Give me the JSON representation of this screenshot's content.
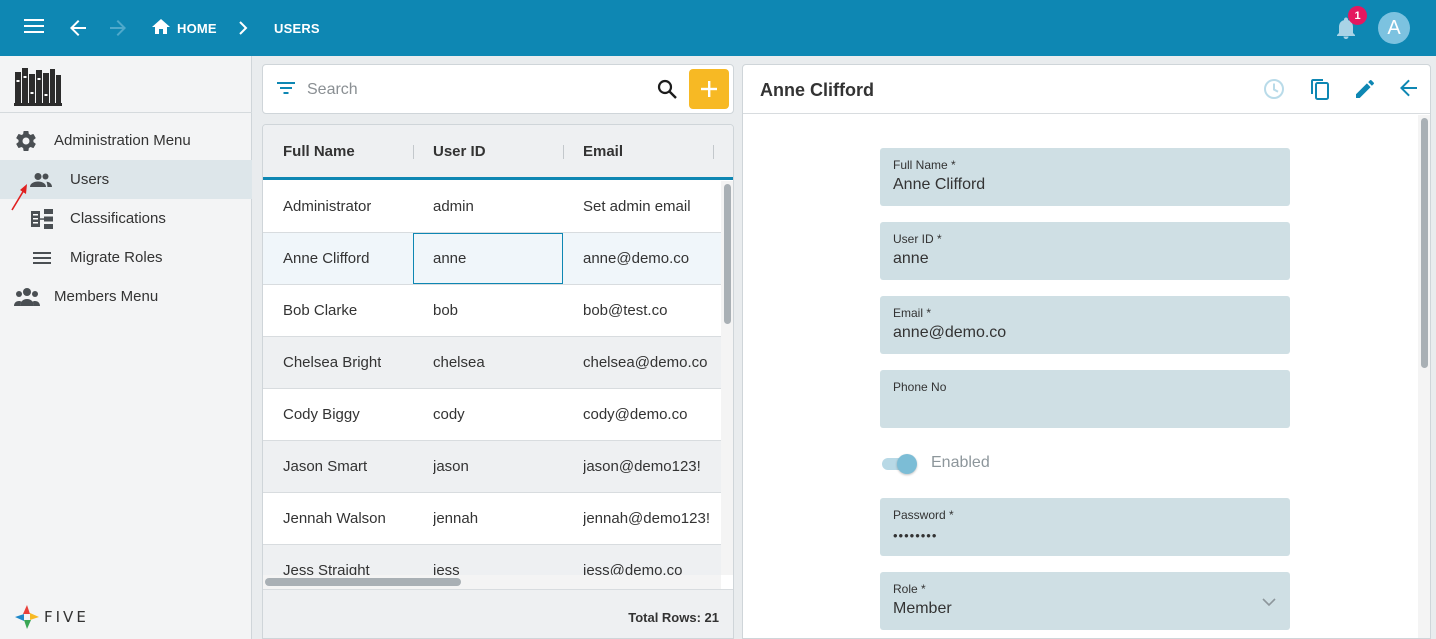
{
  "topbar": {
    "breadcrumbs": [
      "HOME",
      "USERS"
    ],
    "notification_count": "1",
    "avatar_initial": "A"
  },
  "sidebar": {
    "items": [
      {
        "label": "Administration Menu",
        "icon": "gear-icon"
      },
      {
        "label": "Users",
        "icon": "people-icon",
        "active": true
      },
      {
        "label": "Classifications",
        "icon": "tree-icon"
      },
      {
        "label": "Migrate Roles",
        "icon": "lines-icon"
      },
      {
        "label": "Members Menu",
        "icon": "group-icon"
      }
    ],
    "brand": "FIVE"
  },
  "search": {
    "placeholder": "Search"
  },
  "grid": {
    "columns": [
      "Full Name",
      "User ID",
      "Email"
    ],
    "rows": [
      [
        "Administrator",
        "admin",
        "Set admin email"
      ],
      [
        "Anne Clifford",
        "anne",
        "anne@demo.co"
      ],
      [
        "Bob Clarke",
        "bob",
        "bob@test.co"
      ],
      [
        "Chelsea Bright",
        "chelsea",
        "chelsea@demo.co"
      ],
      [
        "Cody Biggy",
        "cody",
        "cody@demo.co"
      ],
      [
        "Jason Smart",
        "jason",
        "jason@demo123!"
      ],
      [
        "Jennah Walson",
        "jennah",
        "jennah@demo123!"
      ],
      [
        "Jess Straight",
        "jess",
        "jess@demo.co"
      ]
    ],
    "selected_row": 1,
    "total_label": "Total Rows: 21"
  },
  "detail": {
    "title": "Anne Clifford",
    "fields": [
      {
        "label": "Full Name *",
        "value": "Anne Clifford"
      },
      {
        "label": "User ID *",
        "value": "anne"
      },
      {
        "label": "Email *",
        "value": "anne@demo.co"
      },
      {
        "label": "Phone No",
        "value": ""
      }
    ],
    "toggle_label": "Enabled",
    "toggle_on": true,
    "password": {
      "label": "Password *",
      "value": "••••••••"
    },
    "role": {
      "label": "Role *",
      "value": "Member"
    }
  },
  "colors": {
    "primary": "#0e87b3",
    "accent": "#f7b924",
    "badge": "#e5175f",
    "field_bg": "#cfdfe4"
  }
}
